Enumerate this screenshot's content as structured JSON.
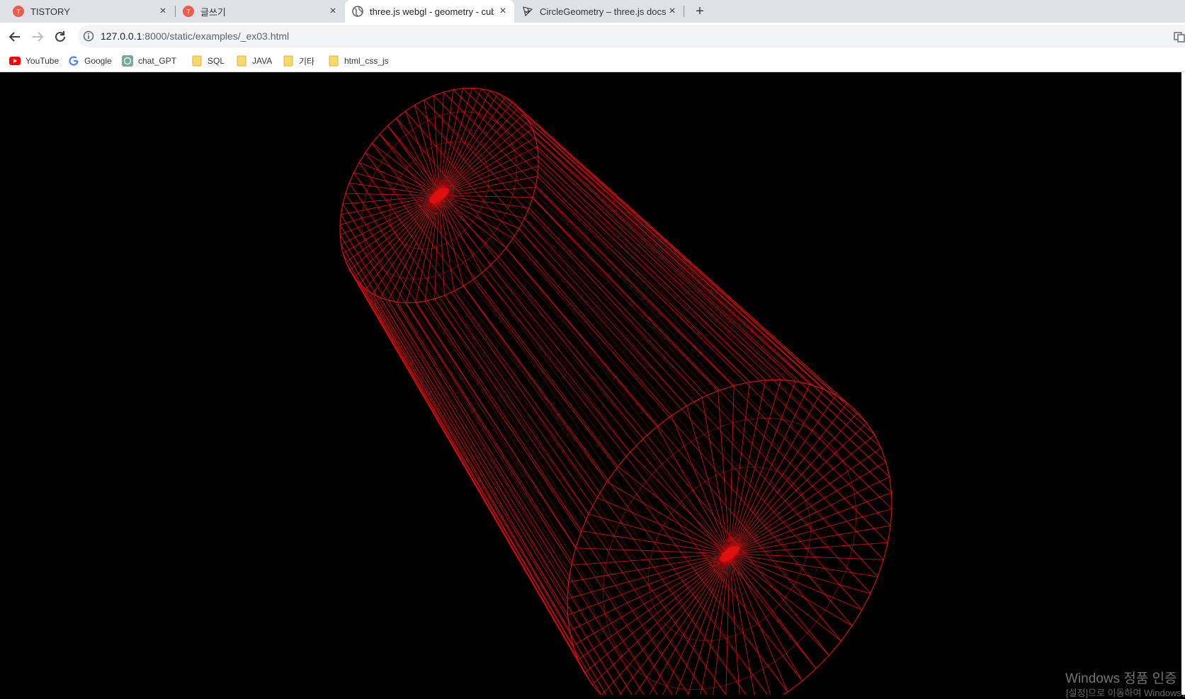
{
  "tabs": [
    {
      "title": "TISTORY",
      "icon": "tistory-icon",
      "active": false
    },
    {
      "title": "글쓰기",
      "icon": "tistory-icon",
      "active": false
    },
    {
      "title": "three.js webgl - geometry - cub",
      "icon": "globe-icon",
      "active": true
    },
    {
      "title": "CircleGeometry – three.js docs",
      "icon": "threejs-icon",
      "active": false
    }
  ],
  "address": {
    "host": "127.0.0.1",
    "rest": ":8000/static/examples/_ex03.html"
  },
  "bookmarks": [
    {
      "label": "YouTube",
      "icon": "youtube-icon"
    },
    {
      "label": "Google",
      "icon": "google-icon"
    },
    {
      "label": "chat_GPT",
      "icon": "chatgpt-icon"
    },
    {
      "label": "SQL",
      "icon": "folder-icon"
    },
    {
      "label": "JAVA",
      "icon": "folder-icon"
    },
    {
      "label": "기타",
      "icon": "folder-icon"
    },
    {
      "label": "html_css_js",
      "icon": "folder-icon"
    }
  ],
  "scene": {
    "object": "wireframe cylinder",
    "wire_color": "#e01010",
    "background": "#000000"
  },
  "os_watermark": {
    "line1": "Windows 정품 인증",
    "line2": "[설정]으로 이동하여 Windows를 정품 인증합니다."
  }
}
